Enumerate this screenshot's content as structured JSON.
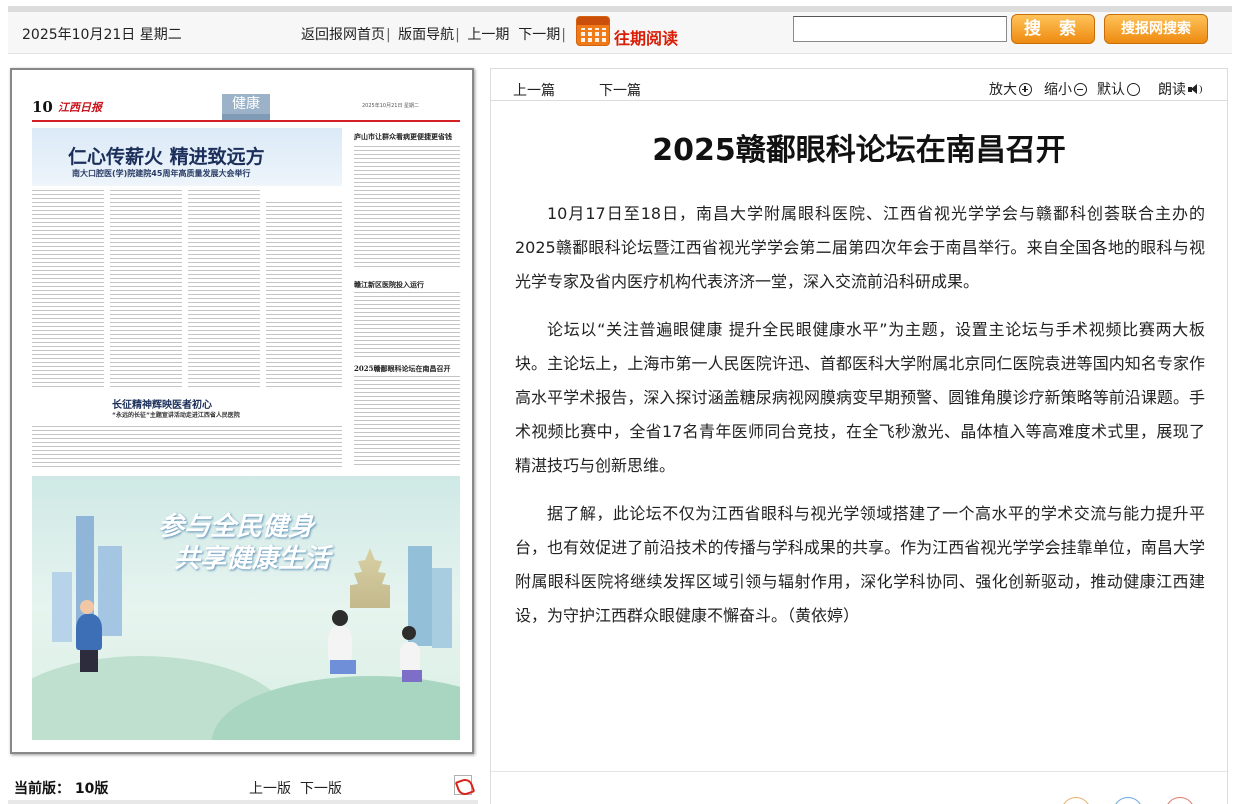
{
  "header": {
    "date": "2025年10月21日 星期二",
    "nav": [
      {
        "label": "返回报网首页"
      },
      {
        "label": "版面导航"
      },
      {
        "label": "上一期"
      },
      {
        "label": "下一期"
      }
    ],
    "archive_label": "往期阅读",
    "search_value": "",
    "search_button": "搜 索",
    "site_search_button": "搜报网搜索"
  },
  "newspaper": {
    "page_number": "10",
    "logo": "江西日报",
    "section": "健康",
    "date_line": "2025年10月21日 星期二",
    "headline": "仁心传薪火  精进致远方",
    "subheadline": "南大口腔医(学)院建院45周年高质量发展大会举行",
    "side_headline_1": "庐山市让群众看病更便捷更省钱",
    "side_headline_2": "赣江新区医院投入运行",
    "side_headline_3": "2025赣鄱眼科论坛在南昌召开",
    "headline_2": "长征精神辉映医者初心",
    "subheadline_2": "“永远的长征”主题宣讲活动走进江西省人民医院",
    "ad_line_1": "参与全民健身",
    "ad_line_2": "共享健康生活"
  },
  "edition": {
    "current_label": "当前版：",
    "current_value": "10版",
    "prev": "上一版",
    "next": "下一版"
  },
  "article": {
    "toolbar": {
      "prev": "上一篇",
      "next": "下一篇",
      "zoom_in": "放大",
      "zoom_out": "缩小",
      "default": "默认",
      "read_aloud": "朗读"
    },
    "title": "2025赣鄱眼科论坛在南昌召开",
    "paragraphs": [
      "10月17日至18日，南昌大学附属眼科医院、江西省视光学学会与赣鄱科创荟联合主办的2025赣鄱眼科论坛暨江西省视光学学会第二届第四次年会于南昌举行。来自全国各地的眼科与视光学专家及省内医疗机构代表济济一堂，深入交流前沿科研成果。",
      "论坛以“关注普遍眼健康 提升全民眼健康水平”为主题，设置主论坛与手术视频比赛两大板块。主论坛上，上海市第一人民医院许迅、首都医科大学附属北京同仁医院袁进等国内知名专家作高水平学术报告，深入探讨涵盖糖尿病视网膜病变早期预警、圆锥角膜诊疗新策略等前沿课题。手术视频比赛中，全省17名青年医师同台竞技，在全飞秒激光、晶体植入等高难度术式里，展现了精湛技巧与创新思维。",
      "据了解，此论坛不仅为江西省眼科与视光学领域搭建了一个高水平的学术交流与能力提升平台，也有效促进了前沿技术的传播与学科成果的共享。作为江西省视光学学会挂靠单位，南昌大学附属眼科医院将继续发挥区域引领与辐射作用，深化学科协同、强化创新驱动，推动健康江西建设，为守护江西群众眼健康不懈奋斗。（黄依婷）"
    ]
  },
  "colors": {
    "archive_red": "#d81e06",
    "button_orange": "#ee8a10",
    "masthead_red": "#c8111b",
    "hero_navy": "#1b2f5a"
  }
}
